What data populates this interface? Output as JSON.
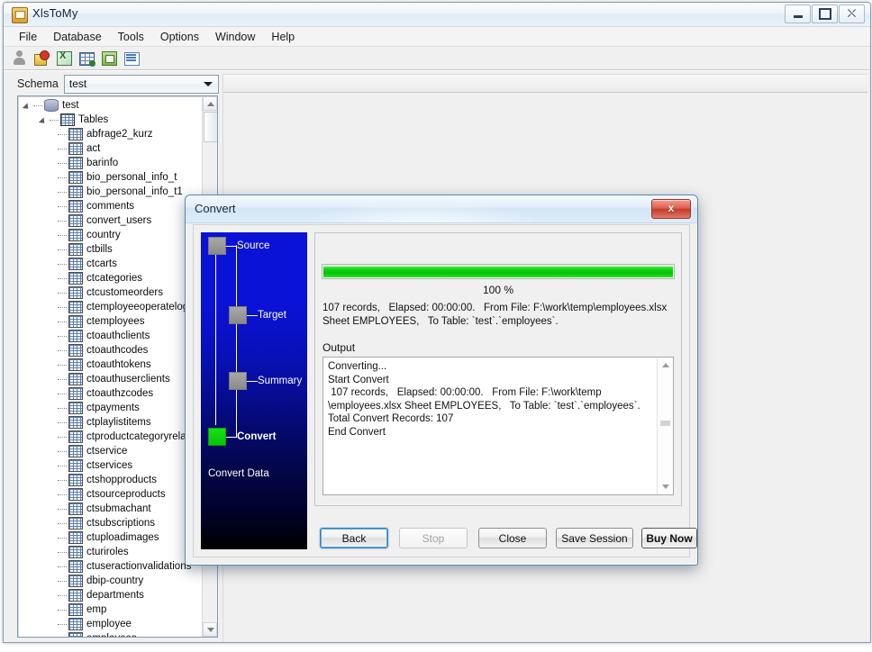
{
  "window": {
    "title": "XlsToMy",
    "icon": "app-icon",
    "controls": {
      "minimize": "–",
      "maximize": "□",
      "close": "✕"
    }
  },
  "menubar": {
    "items": [
      "File",
      "Database",
      "Tools",
      "Options",
      "Window",
      "Help"
    ]
  },
  "toolbar": {
    "icons": [
      "user-icon",
      "lock-denied-icon",
      "excel-sheet-icon",
      "table-grid-icon",
      "window-tile-icon",
      "list-view-icon"
    ]
  },
  "schema": {
    "label": "Schema",
    "selected": "test",
    "placeholder": "test"
  },
  "tree": {
    "root": "test",
    "group": "Tables",
    "tables": [
      "abfrage2_kurz",
      "act",
      "barinfo",
      "bio_personal_info_t",
      "bio_personal_info_t1",
      "comments",
      "convert_users",
      "country",
      "ctbills",
      "ctcarts",
      "ctcategories",
      "ctcustomeorders",
      "ctemployeeoperatelogs",
      "ctemployees",
      "ctoauthclients",
      "ctoauthcodes",
      "ctoauthtokens",
      "ctoauthuserclients",
      "ctoauthzcodes",
      "ctpayments",
      "ctplaylistitems",
      "ctproductcategoryrelati",
      "ctservice",
      "ctservices",
      "ctshopproducts",
      "ctsourceproducts",
      "ctsubmachant",
      "ctsubscriptions",
      "ctuploadimages",
      "cturiroles",
      "ctuseractionvalidations",
      "dbip-country",
      "departments",
      "emp",
      "employee",
      "employees"
    ]
  },
  "dialog": {
    "title": "Convert",
    "close_glyph": "x",
    "steps": [
      {
        "label": "Source",
        "state": "done"
      },
      {
        "label": "Target",
        "state": "done"
      },
      {
        "label": "Summary",
        "state": "done"
      },
      {
        "label": "Convert",
        "state": "active"
      }
    ],
    "footer": "Convert Data",
    "progress": {
      "percent": 100,
      "percent_label": "100 %"
    },
    "summary": "107 records,   Elapsed: 00:00:00.   From File: F:\\work\\temp\\employees.xlsx\nSheet EMPLOYEES,   To Table: `test`.`employees`.",
    "output": {
      "label": "Output",
      "text": "Converting...\nStart Convert\n 107 records,   Elapsed: 00:00:00.   From File: F:\\work\\temp\n\\employees.xlsx Sheet EMPLOYEES,   To Table: `test`.`employees`.\nTotal Convert Records: 107\nEnd Convert"
    },
    "buttons": [
      {
        "label": "Back",
        "state": "focused"
      },
      {
        "label": "Stop",
        "state": "disabled"
      },
      {
        "label": "Close",
        "state": "normal"
      },
      {
        "label": "Save Session",
        "state": "normal"
      },
      {
        "label": "Buy Now",
        "state": "strong"
      }
    ]
  },
  "colors": {
    "progress_green": "#07c107",
    "step_active": "#16e016",
    "steps_gradient_top": "#0b12d8",
    "dialog_close_red": "#c33a28"
  }
}
